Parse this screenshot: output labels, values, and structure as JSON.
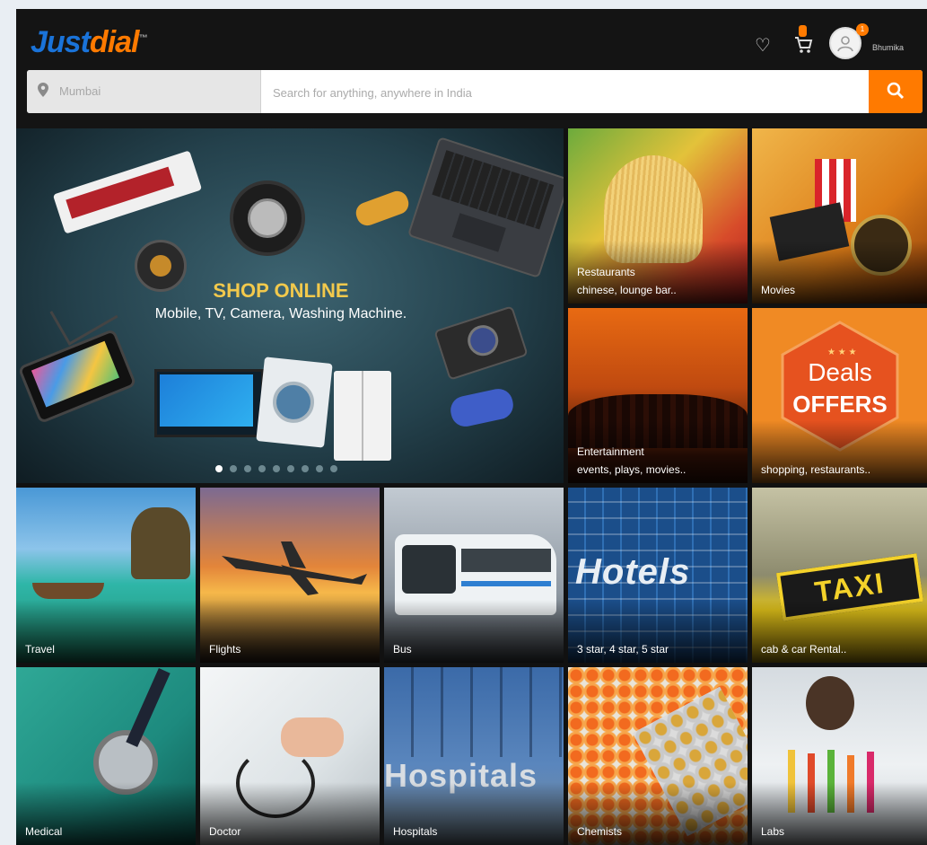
{
  "header": {
    "logo_part1": "Just",
    "logo_part2": "dial",
    "cart_badge": "",
    "avatar_badge": "1",
    "username": "Bhumika",
    "city_value": "Mumbai",
    "search_placeholder": "Search for anything, anywhere in India"
  },
  "hero": {
    "title": "SHOP ONLINE",
    "subtitle": "Mobile, TV, Camera, Washing Machine.",
    "dot_count": 9,
    "active_dot": 1
  },
  "tiles": {
    "restaurants": {
      "title": "Restaurants",
      "sub": "chinese, lounge bar.."
    },
    "movies": {
      "title": "Movies"
    },
    "entertainment": {
      "title": "Entertainment",
      "sub": "events, plays, movies.."
    },
    "deals": {
      "badge_top": "Deals",
      "badge_bottom": "OFFERS",
      "sub": "shopping, restaurants.."
    },
    "travel": {
      "title": "Travel"
    },
    "flights": {
      "title": "Flights"
    },
    "bus": {
      "title": "Bus"
    },
    "hotels": {
      "overlay": "Hotels",
      "title": "3 star, 4 star, 5 star"
    },
    "taxi": {
      "overlay": "TAXI",
      "title": "cab & car Rental.."
    },
    "medical": {
      "title": "Medical"
    },
    "doctor": {
      "title": "Doctor"
    },
    "hospitals": {
      "overlay": "Hospitals",
      "title": "Hospitals"
    },
    "chemists": {
      "title": "Chemists"
    },
    "labs": {
      "title": "Labs"
    }
  },
  "colors": {
    "brand_blue": "#1a73d9",
    "brand_orange": "#ff7a00",
    "header_bg": "#141414"
  }
}
